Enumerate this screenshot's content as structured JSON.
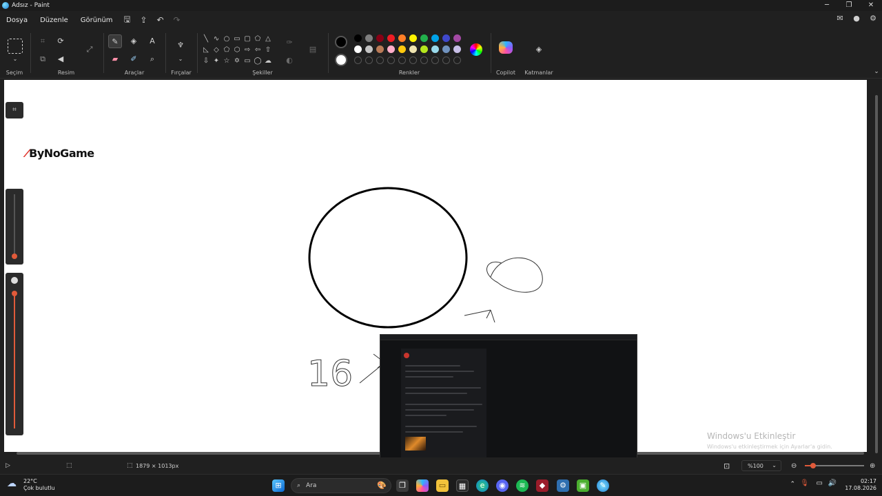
{
  "window": {
    "title": "Adsız - Paint"
  },
  "menu": {
    "file": "Dosya",
    "edit": "Düzenle",
    "view": "Görünüm"
  },
  "ribbon": {
    "selection_label": "Seçim",
    "image_label": "Resim",
    "tools_label": "Araçlar",
    "brushes_label": "Fırçalar",
    "shapes_label": "Şekiller",
    "colors_label": "Renkler",
    "copilot_label": "Copilot",
    "layers_label": "Katmanlar"
  },
  "palette": {
    "primary": "#000000",
    "secondary": "#ffffff",
    "row1": [
      "#000000",
      "#7f7f7f",
      "#880015",
      "#ed1c24",
      "#ff7f27",
      "#fff200",
      "#22b14c",
      "#00a2e8",
      "#3f48cc",
      "#a349a4"
    ],
    "row2": [
      "#ffffff",
      "#c3c3c3",
      "#b97a57",
      "#ffaec9",
      "#ffc90e",
      "#efe4b0",
      "#b5e61d",
      "#99d9ea",
      "#7092be",
      "#c8bfe7"
    ]
  },
  "canvas": {
    "logo_text": "ByNoGame",
    "drawing_text": "16"
  },
  "watermark": {
    "title": "Windows'u Etkinleştir",
    "subtitle": "Windows'u etkinleştirmek için Ayarlar'a gidin."
  },
  "status": {
    "canvas_size": "1879 × 1013px",
    "zoom": "%100",
    "zoom_level_percent": 100
  },
  "taskbar": {
    "weather_temp": "22°C",
    "weather_desc": "Çok bulutlu",
    "search_placeholder": "Ara",
    "time": "02:17",
    "date": "17.08.2026"
  }
}
